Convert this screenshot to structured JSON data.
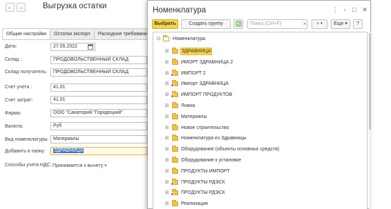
{
  "form": {
    "title": "Выгрузка остатки",
    "back_icon": "←",
    "forward_icon": "→",
    "tabs": [
      {
        "label": "Общие настройки"
      },
      {
        "label": "Остатки экспорт"
      },
      {
        "label": "Расходное требование"
      }
    ],
    "fields": {
      "date": {
        "label": "Дата:",
        "value": "27.05.2022"
      },
      "warehouse": {
        "label": "Склад :",
        "value": "ПРОДОВОЛЬСТВЕННЫЙ СКЛАД"
      },
      "warehouse_receiver": {
        "label": "Склад получатель:",
        "value": "ПРОДОВОЛЬСТВЕННЫЙ СКЛАД"
      },
      "account": {
        "label": "Счет учета :",
        "value": "41.01"
      },
      "cost_account": {
        "label": "Счет затрат:",
        "value": "41.01"
      },
      "company": {
        "label": "Фирма:",
        "value": "ООО \"Санаторий \"Городецкий\""
      },
      "currency": {
        "label": "Валюта:",
        "value": "Руб"
      },
      "nomenclature_type": {
        "label": "Вид номенклатуры:",
        "value": "Материалы"
      },
      "add_to_folder": {
        "label": "Добавить в папку:",
        "value": "ЗДРАВНИЦА"
      },
      "vat_method": {
        "label": "Способы учета НДС:",
        "value": "Принимается к вычету"
      }
    }
  },
  "modal": {
    "title": "Номенклатура",
    "controls": {
      "menu": "⋮",
      "restore": "▫",
      "maximize": "□",
      "close": "✕"
    },
    "toolbar": {
      "select_label": "Выбрать",
      "create_group_label": "Создать группу",
      "search_placeholder": "Поиск (Ctrl+F)",
      "search_clear": "×",
      "search_btn": "⌕ ▾",
      "more_label": "Еще ▾",
      "help_label": "?"
    },
    "tree": {
      "root": "Номенклатура",
      "items": [
        {
          "label": "ЗДРАВНИЦА",
          "badge": false,
          "selected": true
        },
        {
          "label": "ИМОРТ ЗДРАВНИЦА 2",
          "badge": false,
          "selected": false
        },
        {
          "label": "ИМПОРТ 2",
          "badge": true,
          "selected": false
        },
        {
          "label": "Импорт ЗДРАВНИЦА",
          "badge": true,
          "selected": false
        },
        {
          "label": "ИМПОРТ ПРОДУКТОВ",
          "badge": true,
          "selected": false
        },
        {
          "label": "Ложка",
          "badge": false,
          "selected": false
        },
        {
          "label": "Материалы",
          "badge": false,
          "selected": false
        },
        {
          "label": "Новое строительство",
          "badge": false,
          "selected": false
        },
        {
          "label": "Номенклатура из Здравницы",
          "badge": false,
          "selected": false
        },
        {
          "label": "Оборудование (объекты основных средств)",
          "badge": false,
          "selected": false
        },
        {
          "label": "Оборудование к установке",
          "badge": false,
          "selected": false
        },
        {
          "label": "ПРОДУКТЫ ИМПОРТ",
          "badge": false,
          "selected": false
        },
        {
          "label": "ПРОДУКТЫ РДЭСК",
          "badge": true,
          "selected": false
        },
        {
          "label": "ПРОДУКТЫ РДЭСК",
          "badge": true,
          "selected": false
        },
        {
          "label": "Реализация",
          "badge": false,
          "selected": false
        }
      ]
    }
  },
  "colors": {
    "accent_yellow": "#f7d54a",
    "selection_blue": "#3c79c5",
    "badge_red": "#d8462f"
  }
}
